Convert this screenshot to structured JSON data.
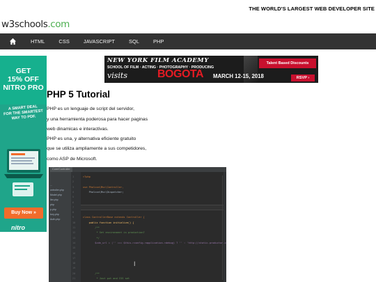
{
  "header": {
    "tagline": "THE WORLD'S LARGEST WEB DEVELOPER SITE",
    "logo_main": "w3schools",
    "logo_tld": ".com"
  },
  "nav": {
    "home_icon": "home-icon",
    "items": [
      "HTML",
      "CSS",
      "JAVASCRIPT",
      "SQL",
      "PHP"
    ]
  },
  "left_ad": {
    "headline_1": "GET",
    "headline_2": "15% OFF",
    "headline_3": "NITRO PRO",
    "pitch_1": "A SMART DEAL",
    "pitch_2": "FOR THE SMARTEST",
    "pitch_3": "WAY TO PDF.",
    "cta": "Buy Now »",
    "brand": "nitro",
    "background_color": "#1fa58a",
    "cta_color": "#f26c2b"
  },
  "banner_ad": {
    "line_1": "NEW YORK FILM ACADEMY",
    "line_2": "SCHOOL OF FILM · ACTING · PHOTOGRAPHY · PRODUCING",
    "visits": "visits",
    "city": "BOGOTA",
    "dates": "MARCH 12-15, 2018",
    "tag": "Talent Based Discounts",
    "rsvp": "RSVP ›"
  },
  "main": {
    "title": "PHP 5 Tutorial",
    "paragraphs": [
      "PHP es un lenguaje de script del servidor,",
      "y una herramienta poderosa para hacer paginas",
      "web dinamicas e interactivas.",
      "PHP es una, y alternativa eficiente gratuito",
      "que se utiliza ampliamente a sus competidores,",
      "como ASP de Microsoft."
    ]
  },
  "code_screenshot": {
    "tab": "Core/Controller",
    "tree_items": [
      "...",
      "ontroller.php",
      "Model.php",
      "ller.php",
      "php",
      "p.php",
      "tory.php",
      "Auth.php"
    ],
    "line_numbers": [
      "1",
      "2",
      "3",
      "4",
      "5",
      "6",
      "7",
      "8",
      "9",
      "10",
      "11",
      "12",
      "13",
      "14",
      "15",
      "16",
      "17",
      "18",
      "19",
      "20",
      "21"
    ],
    "code_lines": [
      "<?php",
      "",
      "use Phalcon\\Mvc\\Controller,",
      "    Phalcon\\Mvc\\Dispatcher;",
      "",
      "",
      "",
      "",
      "class ControllerBase extends Controller {",
      "    public function initialize() {",
      "        /**",
      "         * Set environment is production?",
      "         */",
      "        $cdn_url = ('' === $this->config->application->debug) ? '' : 'http://static.productor.com';",
      "",
      "",
      "",
      "",
      "",
      "        /**",
      "         * Just put and CSS set"
    ]
  }
}
